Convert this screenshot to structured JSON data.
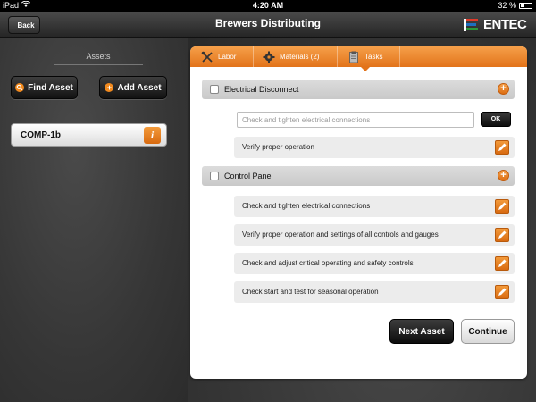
{
  "status_bar": {
    "carrier": "iPad",
    "time": "4:20 AM",
    "battery": "32 %"
  },
  "nav": {
    "back_label": "Back",
    "title": "Brewers Distributing",
    "logo_text": "ENTEC"
  },
  "sidebar": {
    "assets_label": "Assets",
    "find_asset_label": "Find Asset",
    "add_asset_label": "Add Asset",
    "asset_items": [
      {
        "name": "COMP-1b"
      }
    ]
  },
  "tabs": [
    {
      "label": "Labor"
    },
    {
      "label": "Materials (2)"
    },
    {
      "label": "Tasks"
    }
  ],
  "sections": [
    {
      "title": "Electrical Disconnect",
      "new_task_placeholder": "Check and tighten electrical connections",
      "ok_label": "OK",
      "tasks": [
        "Verify proper operation"
      ]
    },
    {
      "title": "Control Panel",
      "tasks": [
        "Check and tighten electrical connections",
        "Verify proper operation and settings of all controls and gauges",
        "Check and adjust critical operating and safety controls",
        "Check start and test for seasonal operation"
      ]
    }
  ],
  "footer": {
    "next_asset_label": "Next Asset",
    "continue_label": "Continue"
  },
  "colors": {
    "accent": "#e8801f",
    "dark": "#1a1a1a",
    "chalkboard": "#3a3a3a"
  }
}
